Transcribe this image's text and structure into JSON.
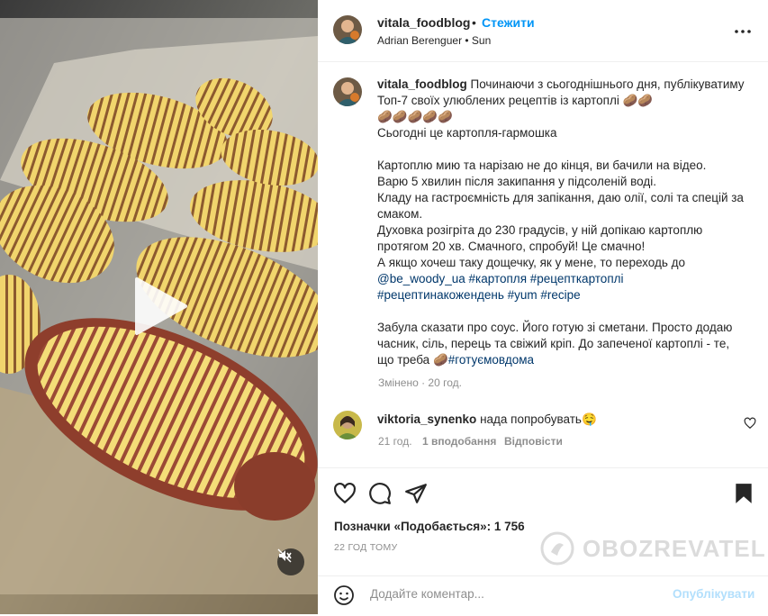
{
  "post": {
    "username": "vitala_foodblog",
    "follow_label": "Стежити",
    "separator": "•",
    "subtitle": "Adrian Berenguer • Sun"
  },
  "caption": {
    "username": "vitala_foodblog",
    "text_p1": " Починаючи з сьогоднішнього дня, публікуватиму Топ-7 своїх улюблених рецептів із картоплі 🥔🥔\n🥔🥔🥔🥔🥔\nСьогодні це картопля-гармошка\n\nКартоплю мию та нарізаю не до кінця, ви бачили на відео.\nВарю 5 хвилин після закипання у підсоленій воді.\nКладу на гастроємність для запікання, даю олії, солі та спецій за смаком.\nДуховка розігріта до 230 градусів, у ній допікаю картоплю протягом 20 хв. Смачного, спробуй! Це смачно!\nА якщо хочеш таку дощечку, як у мене, то переходь до\n",
    "mention": "@be_woody_ua",
    "hashtags_1": " #картопля #рецепткартоплі\n#рецептинакожендень #yum #recipe",
    "text_p2": "\n\nЗабула сказати про соус. Його готую зі сметани. Просто додаю часник, сіль, перець та свіжий кріп. До запеченої картоплі - те, що треба 🥔",
    "hashtag_last": "#готуємовдома",
    "meta": "Змінено · 20 год."
  },
  "comment": {
    "username": "viktoria_synenko",
    "text": " нада попробувать🤤",
    "time": "21 год.",
    "likes": "1 вподобання",
    "reply": "Відповісти"
  },
  "actions": {
    "likes_label": "Позначки «Подобається»: 1 756",
    "date": "22 ГОД ТОМУ"
  },
  "add_comment": {
    "placeholder": "Додайте коментар...",
    "publish_label": "Опублікувати"
  },
  "watermark": {
    "text": "OBOZREVATEL"
  },
  "colors": {
    "accent": "#0095f6",
    "link": "#00376b",
    "muted": "#8e8e8e"
  },
  "icons": [
    "play-icon",
    "mute-icon",
    "more-icon",
    "heart-icon",
    "comment-icon",
    "share-icon",
    "bookmark-icon",
    "emoji-icon"
  ]
}
